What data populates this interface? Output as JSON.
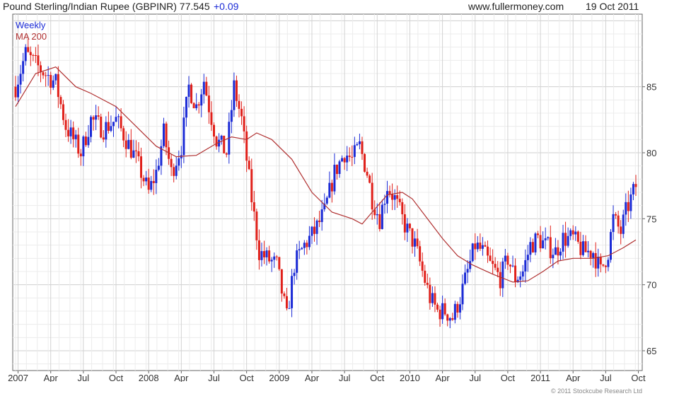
{
  "header": {
    "title": "Pound Sterling/Indian Rupee (GBPINR) 77.545",
    "change": "+0.09",
    "site": "www.fullermoney.com",
    "date": "19 Oct 2011"
  },
  "footer": {
    "copyright": "© 2011 Stockcube Research Ltd"
  },
  "chart_data": {
    "type": "candlestick",
    "xlabel": "",
    "ylabel": "",
    "ylim": [
      63.5,
      90.5
    ],
    "yticks": [
      65,
      70,
      75,
      80,
      85
    ],
    "xticks": [
      "2007",
      "Apr",
      "Jul",
      "Oct",
      "2008",
      "Apr",
      "Jul",
      "Oct",
      "2009",
      "Apr",
      "Jul",
      "Oct",
      "2010",
      "Apr",
      "Jul",
      "Oct",
      "2011",
      "Apr",
      "Jul",
      "Oct"
    ],
    "grid": true,
    "legend": [
      "Weekly",
      "MA 200"
    ],
    "colors": {
      "up": "#1b2bd6",
      "down": "#e0201a",
      "ma": "#b03030",
      "grid": "#d8d8d8"
    },
    "price_path": [
      {
        "x": 0,
        "y": 85.0
      },
      {
        "x": 4,
        "y": 87.5
      },
      {
        "x": 10,
        "y": 86.3
      },
      {
        "x": 16,
        "y": 85.3
      },
      {
        "x": 20,
        "y": 82.0
      },
      {
        "x": 26,
        "y": 80.0
      },
      {
        "x": 30,
        "y": 82.5
      },
      {
        "x": 35,
        "y": 81.8
      },
      {
        "x": 40,
        "y": 82.5
      },
      {
        "x": 44,
        "y": 81.0
      },
      {
        "x": 48,
        "y": 79.5
      },
      {
        "x": 51,
        "y": 78.0
      },
      {
        "x": 53,
        "y": 77.0
      },
      {
        "x": 56,
        "y": 78.5
      },
      {
        "x": 59,
        "y": 81.5
      },
      {
        "x": 62,
        "y": 78.5
      },
      {
        "x": 66,
        "y": 80.5
      },
      {
        "x": 69,
        "y": 85.0
      },
      {
        "x": 72,
        "y": 83.5
      },
      {
        "x": 75,
        "y": 85.5
      },
      {
        "x": 77,
        "y": 83.5
      },
      {
        "x": 80,
        "y": 81.0
      },
      {
        "x": 84,
        "y": 80.0
      },
      {
        "x": 87,
        "y": 85.0
      },
      {
        "x": 90,
        "y": 82.5
      },
      {
        "x": 94,
        "y": 76.5
      },
      {
        "x": 97,
        "y": 72.5
      },
      {
        "x": 100,
        "y": 72.0
      },
      {
        "x": 104,
        "y": 71.5
      },
      {
        "x": 106,
        "y": 69.5
      },
      {
        "x": 108,
        "y": 67.5
      },
      {
        "x": 111,
        "y": 71.5
      },
      {
        "x": 115,
        "y": 73.0
      },
      {
        "x": 119,
        "y": 74.0
      },
      {
        "x": 123,
        "y": 75.5
      },
      {
        "x": 127,
        "y": 78.5
      },
      {
        "x": 131,
        "y": 80.0
      },
      {
        "x": 134,
        "y": 79.5
      },
      {
        "x": 137,
        "y": 80.5
      },
      {
        "x": 140,
        "y": 78.5
      },
      {
        "x": 142,
        "y": 76.5
      },
      {
        "x": 145,
        "y": 75.0
      },
      {
        "x": 148,
        "y": 77.5
      },
      {
        "x": 151,
        "y": 76.5
      },
      {
        "x": 155,
        "y": 74.5
      },
      {
        "x": 159,
        "y": 73.0
      },
      {
        "x": 162,
        "y": 71.0
      },
      {
        "x": 165,
        "y": 69.0
      },
      {
        "x": 168,
        "y": 68.0
      },
      {
        "x": 171,
        "y": 68.0
      },
      {
        "x": 174,
        "y": 67.5
      },
      {
        "x": 177,
        "y": 69.0
      },
      {
        "x": 180,
        "y": 71.0
      },
      {
        "x": 183,
        "y": 73.0
      },
      {
        "x": 186,
        "y": 72.5
      },
      {
        "x": 189,
        "y": 71.5
      },
      {
        "x": 193,
        "y": 70.5
      },
      {
        "x": 196,
        "y": 72.0
      },
      {
        "x": 199,
        "y": 70.5
      },
      {
        "x": 202,
        "y": 71.0
      },
      {
        "x": 205,
        "y": 73.0
      },
      {
        "x": 208,
        "y": 73.5
      },
      {
        "x": 211,
        "y": 73.0
      },
      {
        "x": 215,
        "y": 72.5
      },
      {
        "x": 218,
        "y": 73.5
      },
      {
        "x": 222,
        "y": 73.5
      },
      {
        "x": 226,
        "y": 72.5
      },
      {
        "x": 230,
        "y": 72.5
      },
      {
        "x": 233,
        "y": 71.0
      },
      {
        "x": 236,
        "y": 72.5
      },
      {
        "x": 238,
        "y": 75.0
      },
      {
        "x": 241,
        "y": 74.0
      },
      {
        "x": 243,
        "y": 75.5
      },
      {
        "x": 245,
        "y": 76.5
      },
      {
        "x": 247,
        "y": 77.5
      }
    ],
    "ma_path": [
      {
        "x": 0,
        "y": 83.5
      },
      {
        "x": 8,
        "y": 86.0
      },
      {
        "x": 16,
        "y": 86.5
      },
      {
        "x": 24,
        "y": 85.0
      },
      {
        "x": 30,
        "y": 84.5
      },
      {
        "x": 40,
        "y": 83.5
      },
      {
        "x": 48,
        "y": 82.0
      },
      {
        "x": 56,
        "y": 80.5
      },
      {
        "x": 64,
        "y": 79.7
      },
      {
        "x": 72,
        "y": 79.8
      },
      {
        "x": 80,
        "y": 80.7
      },
      {
        "x": 86,
        "y": 81.2
      },
      {
        "x": 92,
        "y": 81.0
      },
      {
        "x": 96,
        "y": 81.5
      },
      {
        "x": 102,
        "y": 81.0
      },
      {
        "x": 110,
        "y": 79.5
      },
      {
        "x": 118,
        "y": 77.0
      },
      {
        "x": 126,
        "y": 75.5
      },
      {
        "x": 134,
        "y": 75.0
      },
      {
        "x": 138,
        "y": 74.6
      },
      {
        "x": 142,
        "y": 75.5
      },
      {
        "x": 148,
        "y": 76.8
      },
      {
        "x": 154,
        "y": 77.0
      },
      {
        "x": 158,
        "y": 76.5
      },
      {
        "x": 164,
        "y": 75.0
      },
      {
        "x": 170,
        "y": 73.5
      },
      {
        "x": 176,
        "y": 72.2
      },
      {
        "x": 182,
        "y": 71.5
      },
      {
        "x": 190,
        "y": 70.8
      },
      {
        "x": 198,
        "y": 70.2
      },
      {
        "x": 204,
        "y": 70.3
      },
      {
        "x": 210,
        "y": 71.0
      },
      {
        "x": 216,
        "y": 71.8
      },
      {
        "x": 222,
        "y": 72.0
      },
      {
        "x": 230,
        "y": 72.0
      },
      {
        "x": 236,
        "y": 72.2
      },
      {
        "x": 242,
        "y": 72.8
      },
      {
        "x": 247,
        "y": 73.4
      }
    ]
  }
}
